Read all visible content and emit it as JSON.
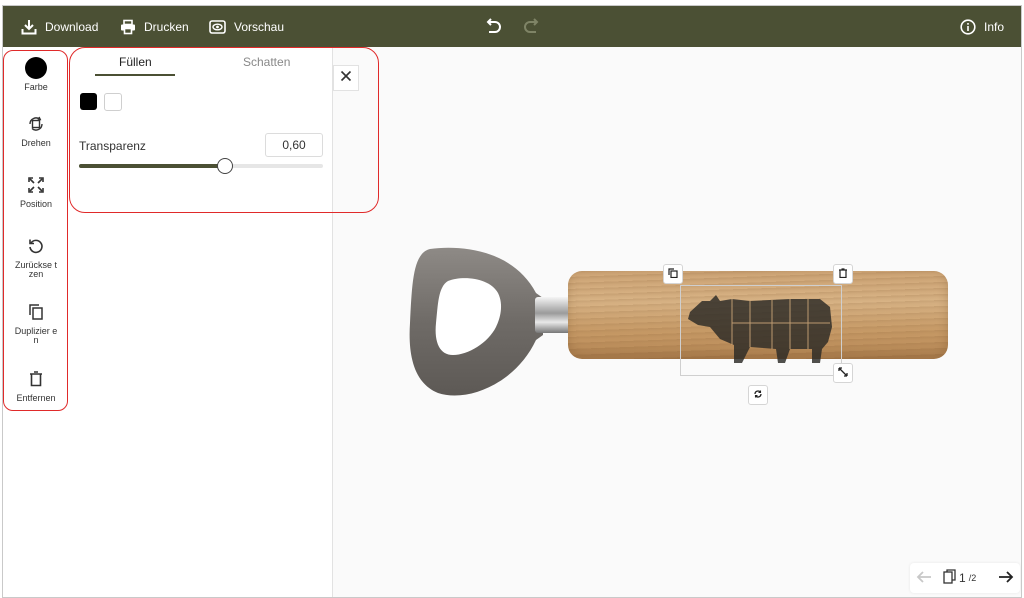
{
  "toolbar": {
    "download_label": "Download",
    "print_label": "Drucken",
    "preview_label": "Vorschau",
    "info_label": "Info"
  },
  "tools": [
    {
      "label": "Farbe",
      "icon": "color-circle-icon"
    },
    {
      "label": "Drehen",
      "icon": "rotate-icon"
    },
    {
      "label": "Position",
      "icon": "position-arrows-icon"
    },
    {
      "label": "Zurückse tzen",
      "icon": "reset-icon"
    },
    {
      "label": "Duplizier en",
      "icon": "duplicate-icon"
    },
    {
      "label": "Entfernen",
      "icon": "trash-icon"
    }
  ],
  "panel": {
    "tabs": [
      "Füllen",
      "Schatten"
    ],
    "active_tab": "Füllen",
    "swatches": [
      "#000000",
      "#ffffff"
    ],
    "transparency_label": "Transparenz",
    "transparency_value": "0,60",
    "transparency_fraction": 0.6
  },
  "pager": {
    "current": "1",
    "total": "/2"
  },
  "colors": {
    "toolbar_bg": "#4b5034",
    "accent": "#4b5034",
    "annotation": "#e02a2a"
  }
}
